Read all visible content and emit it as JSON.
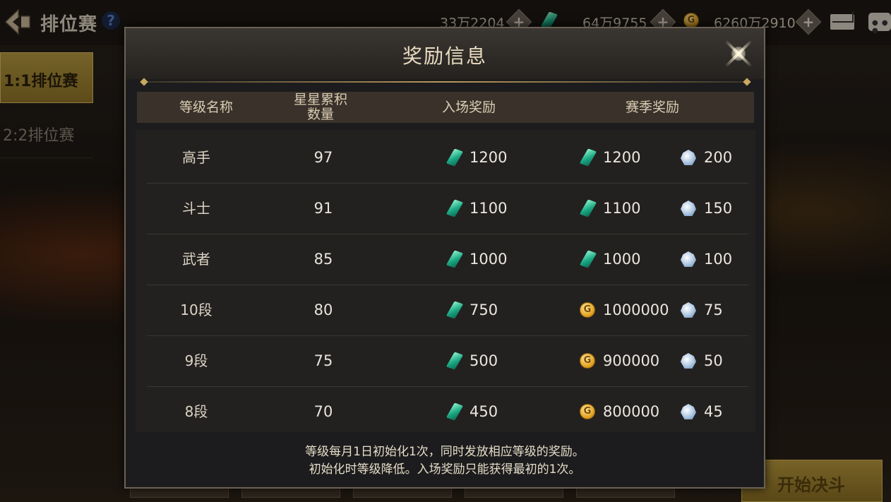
{
  "topbar": {
    "title": "排位赛",
    "help": "?",
    "currency1": "33万2204",
    "currency2": "64万9755",
    "currency3": "6260万2910",
    "plus": "+"
  },
  "sidebar": {
    "items": [
      {
        "label": "1:1排位赛",
        "selected": true
      },
      {
        "label": "2:2排位赛",
        "selected": false
      }
    ]
  },
  "start_button": "开始决斗",
  "modal": {
    "title": "奖励信息",
    "columns": {
      "level_name": "等级名称",
      "stars_line1": "星星累积",
      "stars_line2": "数量",
      "entry_reward": "入场奖励",
      "season_reward": "赛季奖励"
    },
    "rows": [
      {
        "name": "高手",
        "stars": "97",
        "entry_icon": "gem-icon",
        "entry": "1200",
        "season_icon": "gem-icon",
        "season": "1200",
        "extra_icon": "crystal-icon",
        "extra": "200"
      },
      {
        "name": "斗士",
        "stars": "91",
        "entry_icon": "gem-icon",
        "entry": "1100",
        "season_icon": "gem-icon",
        "season": "1100",
        "extra_icon": "crystal-icon",
        "extra": "150"
      },
      {
        "name": "武者",
        "stars": "85",
        "entry_icon": "gem-icon",
        "entry": "1000",
        "season_icon": "gem-icon",
        "season": "1000",
        "extra_icon": "crystal-icon",
        "extra": "100"
      },
      {
        "name": "10段",
        "stars": "80",
        "entry_icon": "gem-icon",
        "entry": "750",
        "season_icon": "gold-coin-icon",
        "season": "1000000",
        "extra_icon": "crystal-icon",
        "extra": "75"
      },
      {
        "name": "9段",
        "stars": "75",
        "entry_icon": "gem-icon",
        "entry": "500",
        "season_icon": "gold-coin-icon",
        "season": "900000",
        "extra_icon": "crystal-icon",
        "extra": "50"
      },
      {
        "name": "8段",
        "stars": "70",
        "entry_icon": "gem-icon",
        "entry": "450",
        "season_icon": "gold-coin-icon",
        "season": "800000",
        "extra_icon": "crystal-icon",
        "extra": "45"
      }
    ],
    "note_line1": "等级每月1日初始化1次，同时发放相应等级的奖励。",
    "note_line2": "初始化时等级降低。入场奖励只能获得最初的1次。"
  },
  "colors": {
    "accent_gold": "#b59840",
    "modal_bg": "#1c1c1e",
    "header_bg": "#3a322a",
    "gem": "#1aa883",
    "coin": "#e3a623"
  }
}
